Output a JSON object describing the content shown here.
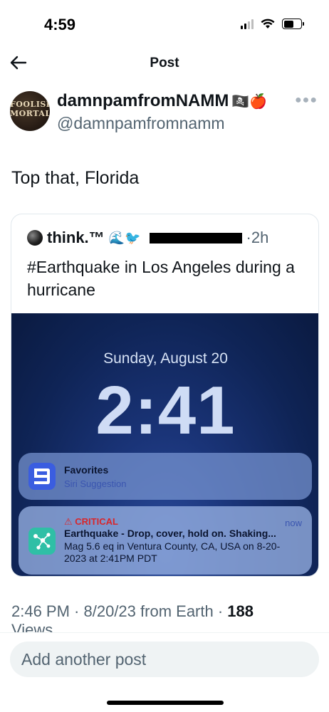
{
  "status_bar": {
    "time": "4:59"
  },
  "header": {
    "title": "Post"
  },
  "author": {
    "display_name": "damnpamfromNAMM",
    "name_emojis": "🏴‍☠️🍎",
    "handle": "@damnpamfromnamm",
    "avatar_text": "FOOLISH MORTAL"
  },
  "tweet": {
    "text": "Top that, Florida"
  },
  "quote": {
    "author_name": "think.™",
    "author_emojis": "🌊🐦",
    "time": "2h",
    "text": "#Earthquake in Los Angeles during a hurricane",
    "lockscreen": {
      "date": "Sunday, August 20",
      "time": "2:41",
      "notifications": [
        {
          "title": "Favorites",
          "subtitle": "Siri Suggestion"
        },
        {
          "label": "⚠ CRITICAL",
          "when": "now",
          "title": "Earthquake - Drop, cover, hold on. Shaking...",
          "body": "Mag 5.6 eq in Ventura County, CA, USA on 8-20-2023 at 2:41PM PDT"
        }
      ]
    }
  },
  "meta": {
    "time": "2:46 PM",
    "date": "8/20/23",
    "source": "from Earth",
    "views_count": "188",
    "views_label": "Views"
  },
  "composer": {
    "placeholder": "Add another post"
  }
}
